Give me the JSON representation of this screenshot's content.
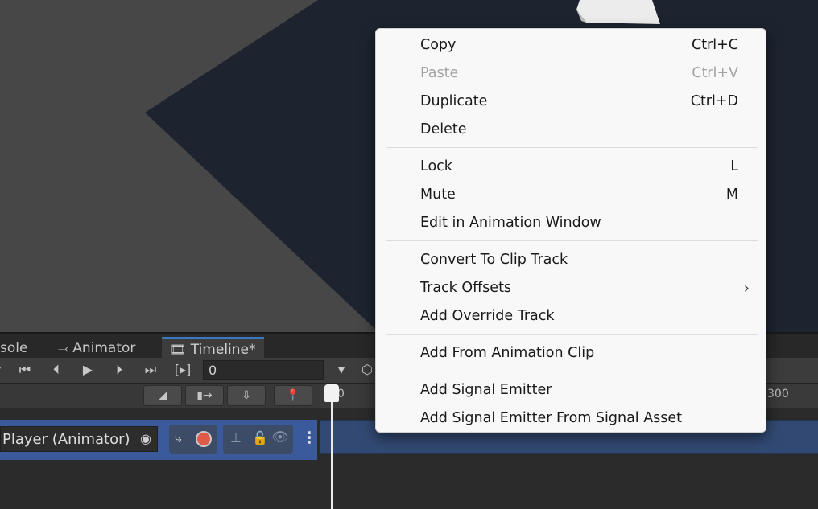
{
  "tabs": [
    {
      "label": "sole",
      "icon": "console-icon"
    },
    {
      "label": "Animator",
      "icon": "animator-icon"
    },
    {
      "label": "Timeline*",
      "icon": "film-icon"
    }
  ],
  "toolbar": {
    "frame_value": "0",
    "buttons": [
      "skip-to-start",
      "previous-frame",
      "play",
      "next-frame",
      "skip-to-end",
      "play-range"
    ]
  },
  "ruler": {
    "labels": [
      "0",
      "300"
    ]
  },
  "track": {
    "name": "Player (Animator)"
  },
  "context_menu": {
    "groups": [
      [
        {
          "label": "Copy",
          "shortcut": "Ctrl+C",
          "enabled": true
        },
        {
          "label": "Paste",
          "shortcut": "Ctrl+V",
          "enabled": false
        },
        {
          "label": "Duplicate",
          "shortcut": "Ctrl+D",
          "enabled": true
        },
        {
          "label": "Delete",
          "shortcut": "",
          "enabled": true
        }
      ],
      [
        {
          "label": "Lock",
          "shortcut": "L",
          "enabled": true
        },
        {
          "label": "Mute",
          "shortcut": "M",
          "enabled": true
        },
        {
          "label": "Edit in Animation Window",
          "shortcut": "",
          "enabled": true
        }
      ],
      [
        {
          "label": "Convert To Clip Track",
          "shortcut": "",
          "enabled": true
        },
        {
          "label": "Track Offsets",
          "shortcut": "",
          "enabled": true,
          "submenu": true
        },
        {
          "label": "Add Override Track",
          "shortcut": "",
          "enabled": true
        }
      ],
      [
        {
          "label": "Add From Animation Clip",
          "shortcut": "",
          "enabled": true
        }
      ],
      [
        {
          "label": "Add Signal Emitter",
          "shortcut": "",
          "enabled": true
        },
        {
          "label": "Add Signal Emitter From Signal Asset",
          "shortcut": "",
          "enabled": true
        }
      ]
    ]
  },
  "colors": {
    "accent": "#3a79bb",
    "track_selected": "#3b5a9c",
    "menu_bg": "#f8f8f8"
  }
}
